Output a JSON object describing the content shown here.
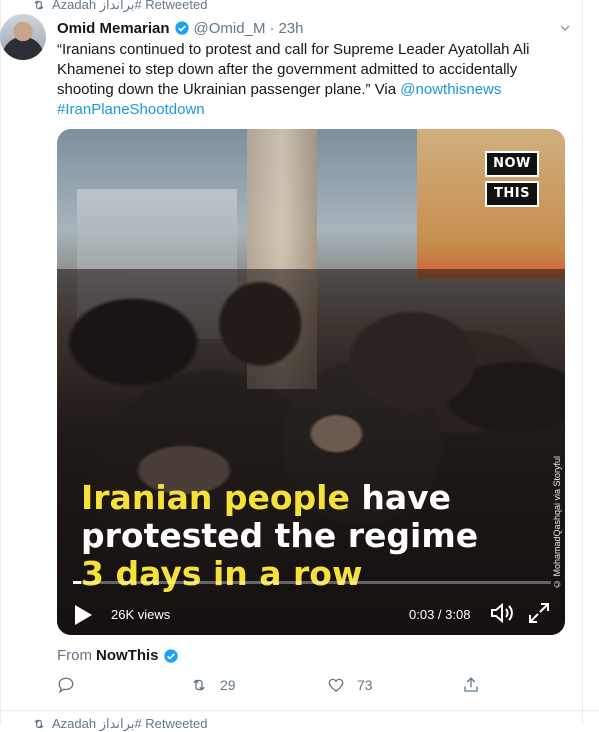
{
  "retweet_banner": {
    "text": "Azadah برانداز# Retweeted",
    "icon": "retweet-icon"
  },
  "author": {
    "display_name": "Omid Memarian",
    "handle": "@Omid_M",
    "separator": "·",
    "timestamp": "23h",
    "verified_color": "#1da1f2"
  },
  "tweet": {
    "text": "“Iranians continued to protest and call for Supreme Leader Ayatollah Ali Khamenei to step down after the government admitted to accidentally shooting down the Ukrainian passenger plane.” Via ",
    "mention": "@nowthisnews",
    "hashtag": "#IranPlaneShootdown"
  },
  "video": {
    "brand_top": "NOW",
    "brand_bottom": "THIS",
    "credit": "© MohamadQashqai via Storyful",
    "caption_line1_highlight": "Iranian people",
    "caption_line1_rest": " have",
    "caption_line2": "protested the regime",
    "caption_line3_highlight": "3 days in a row",
    "views": "26K views",
    "time": "0:03 / 3:08",
    "progress": 0.016,
    "highlight_color": "#f5e13a"
  },
  "source": {
    "prefix": "From",
    "name": "NowThis"
  },
  "actions": {
    "reply_icon": "reply-icon",
    "retweet_count": "29",
    "like_count": "73",
    "share_icon": "share-icon"
  },
  "next_banner": {
    "text": "Azadah برانداز# Retweeted"
  },
  "colors": {
    "accent": "#1b95e0",
    "muted": "#657786"
  }
}
